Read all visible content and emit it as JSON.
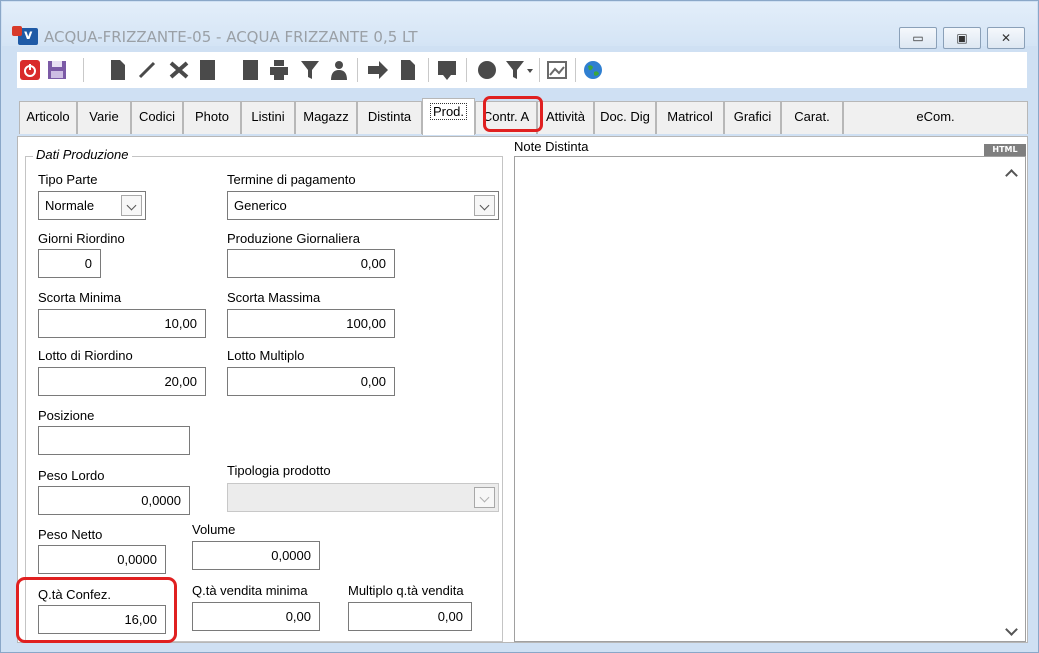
{
  "window": {
    "title": "ACQUA-FRIZZANTE-05 - ACQUA FRIZZANTE 0,5 LT",
    "minimize_glyph": "▭",
    "maximize_glyph": "▣",
    "close_glyph": "✕"
  },
  "toolbar": {
    "icons": [
      "power-icon",
      "save-icon",
      "new-document-icon",
      "edit-icon",
      "delete-icon",
      "copy-icon",
      "paste-icon",
      "print-icon",
      "filter-icon",
      "user-icon",
      "forward-icon",
      "document-icon",
      "attach-icon",
      "circle-icon",
      "filter-dropdown-icon",
      "picture-icon",
      "globe-icon"
    ]
  },
  "tabs": [
    {
      "label": "Articolo"
    },
    {
      "label": "Varie"
    },
    {
      "label": "Codici"
    },
    {
      "label": "Photo"
    },
    {
      "label": "Listini"
    },
    {
      "label": "Magazz"
    },
    {
      "label": "Distinta"
    },
    {
      "label": "Prod.",
      "active": true
    },
    {
      "label": "Contr. A"
    },
    {
      "label": "Attività"
    },
    {
      "label": "Doc. Dig"
    },
    {
      "label": "Matricol"
    },
    {
      "label": "Grafici"
    },
    {
      "label": "Carat."
    },
    {
      "label": "eCom."
    }
  ],
  "form": {
    "group_title": "Dati Produzione",
    "tipo_parte": {
      "label": "Tipo Parte",
      "value": "Normale"
    },
    "termine_pagamento": {
      "label": "Termine di pagamento",
      "value": "Generico"
    },
    "giorni_riordino": {
      "label": "Giorni Riordino",
      "value": "0"
    },
    "produzione_giornaliera": {
      "label": "Produzione Giornaliera",
      "value": "0,00"
    },
    "scorta_minima": {
      "label": "Scorta Minima",
      "value": "10,00"
    },
    "scorta_massima": {
      "label": "Scorta Massima",
      "value": "100,00"
    },
    "lotto_riordino": {
      "label": "Lotto di Riordino",
      "value": "20,00"
    },
    "lotto_multiplo": {
      "label": "Lotto Multiplo",
      "value": "0,00"
    },
    "posizione": {
      "label": "Posizione",
      "value": ""
    },
    "peso_lordo": {
      "label": "Peso Lordo",
      "value": "0,0000"
    },
    "tipologia_prodotto": {
      "label": "Tipologia prodotto",
      "value": ""
    },
    "peso_netto": {
      "label": "Peso Netto",
      "value": "0,0000"
    },
    "volume": {
      "label": "Volume",
      "value": "0,0000"
    },
    "qta_confez": {
      "label": "Q.tà Confez.",
      "value": "16,00"
    },
    "qta_vendita_minima": {
      "label": "Q.tà vendita minima",
      "value": "0,00"
    },
    "multiplo_qta_vendita": {
      "label": "Multiplo q.tà vendita",
      "value": "0,00"
    }
  },
  "notes": {
    "label": "Note Distinta",
    "badge": "HTML"
  },
  "colors": {
    "highlight": "#e02020",
    "titlebar": "#d4e4f5"
  }
}
